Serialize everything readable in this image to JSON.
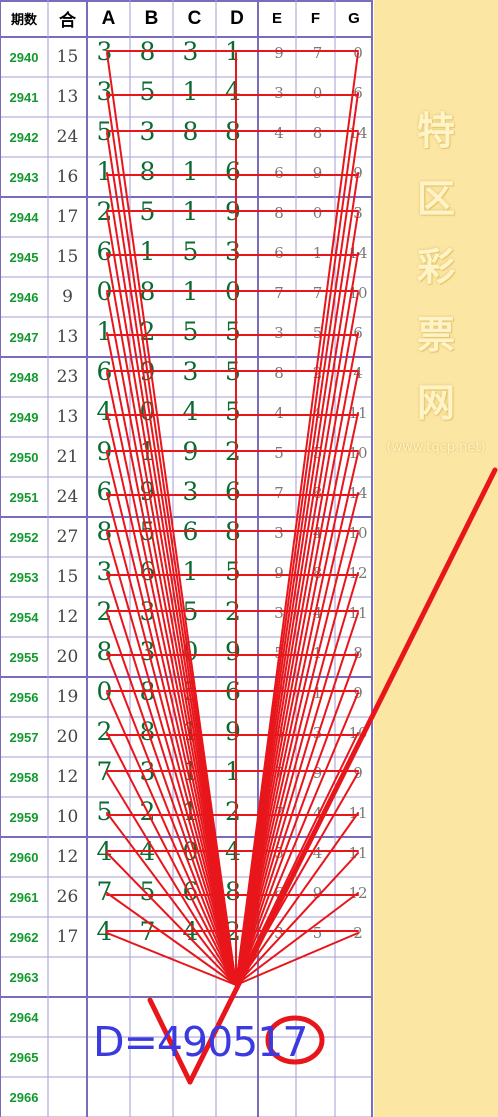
{
  "headers": {
    "period": "期数",
    "sum": "合",
    "cols": [
      "A",
      "B",
      "C",
      "D",
      "E",
      "F",
      "G"
    ]
  },
  "rows": [
    {
      "period": "2940",
      "sum": "15",
      "a": "3",
      "b": "8",
      "c": "3",
      "d": "1",
      "e": "9",
      "f": "7",
      "g": "0"
    },
    {
      "period": "2941",
      "sum": "13",
      "a": "3",
      "b": "5",
      "c": "1",
      "d": "4",
      "e": "3",
      "f": "0",
      "g": "6"
    },
    {
      "period": "2942",
      "sum": "24",
      "a": "5",
      "b": "3",
      "c": "8",
      "d": "8",
      "e": "4",
      "f": "8",
      "g": "14"
    },
    {
      "period": "2943",
      "sum": "16",
      "a": "1",
      "b": "8",
      "c": "1",
      "d": "6",
      "e": "6",
      "f": "9",
      "g": "9"
    },
    {
      "period": "2944",
      "sum": "17",
      "a": "2",
      "b": "5",
      "c": "1",
      "d": "9",
      "e": "8",
      "f": "0",
      "g": "3"
    },
    {
      "period": "2945",
      "sum": "15",
      "a": "6",
      "b": "1",
      "c": "5",
      "d": "3",
      "e": "6",
      "f": "1",
      "g": "14"
    },
    {
      "period": "2946",
      "sum": "9",
      "a": "0",
      "b": "8",
      "c": "1",
      "d": "0",
      "e": "7",
      "f": "7",
      "g": "10"
    },
    {
      "period": "2947",
      "sum": "13",
      "a": "1",
      "b": "2",
      "c": "5",
      "d": "5",
      "e": "3",
      "f": "5",
      "g": "6"
    },
    {
      "period": "2948",
      "sum": "23",
      "a": "6",
      "b": "9",
      "c": "3",
      "d": "5",
      "e": "8",
      "f": "2",
      "g": "4"
    },
    {
      "period": "2949",
      "sum": "13",
      "a": "4",
      "b": "0",
      "c": "4",
      "d": "5",
      "e": "4",
      "f": "4",
      "g": "11"
    },
    {
      "period": "2950",
      "sum": "21",
      "a": "9",
      "b": "1",
      "c": "9",
      "d": "2",
      "e": "5",
      "f": "5",
      "g": "10"
    },
    {
      "period": "2951",
      "sum": "24",
      "a": "6",
      "b": "9",
      "c": "3",
      "d": "6",
      "e": "7",
      "f": "8",
      "g": "14"
    },
    {
      "period": "2952",
      "sum": "27",
      "a": "8",
      "b": "5",
      "c": "6",
      "d": "8",
      "e": "3",
      "f": "4",
      "g": "10"
    },
    {
      "period": "2953",
      "sum": "15",
      "a": "3",
      "b": "6",
      "c": "1",
      "d": "5",
      "e": "9",
      "f": "8",
      "g": "12"
    },
    {
      "period": "2954",
      "sum": "12",
      "a": "2",
      "b": "3",
      "c": "5",
      "d": "2",
      "e": "3",
      "f": "4",
      "g": "11"
    },
    {
      "period": "2955",
      "sum": "20",
      "a": "8",
      "b": "3",
      "c": "0",
      "d": "9",
      "e": "5",
      "f": "1",
      "g": "8"
    },
    {
      "period": "2956",
      "sum": "19",
      "a": "0",
      "b": "8",
      "c": "5",
      "d": "6",
      "e": "7",
      "f": "1",
      "g": "9"
    },
    {
      "period": "2957",
      "sum": "20",
      "a": "2",
      "b": "8",
      "c": "1",
      "d": "9",
      "e": "6",
      "f": "3",
      "g": "10"
    },
    {
      "period": "2958",
      "sum": "12",
      "a": "7",
      "b": "3",
      "c": "1",
      "d": "1",
      "e": "7",
      "f": "9",
      "g": "9"
    },
    {
      "period": "2959",
      "sum": "10",
      "a": "5",
      "b": "2",
      "c": "1",
      "d": "2",
      "e": "7",
      "f": "4",
      "g": "11"
    },
    {
      "period": "2960",
      "sum": "12",
      "a": "4",
      "b": "4",
      "c": "0",
      "d": "4",
      "e": "5",
      "f": "4",
      "g": "11"
    },
    {
      "period": "2961",
      "sum": "26",
      "a": "7",
      "b": "5",
      "c": "6",
      "d": "8",
      "e": "6",
      "f": "9",
      "g": "12"
    },
    {
      "period": "2962",
      "sum": "17",
      "a": "4",
      "b": "7",
      "c": "4",
      "d": "2",
      "e": "3",
      "f": "5",
      "g": "2"
    },
    {
      "period": "2963",
      "sum": "",
      "a": "",
      "b": "",
      "c": "",
      "d": "",
      "e": "",
      "f": "",
      "g": ""
    },
    {
      "period": "2964",
      "sum": "",
      "a": "",
      "b": "",
      "c": "",
      "d": "",
      "e": "",
      "f": "",
      "g": ""
    },
    {
      "period": "2965",
      "sum": "",
      "a": "",
      "b": "",
      "c": "",
      "d": "",
      "e": "",
      "f": "",
      "g": ""
    },
    {
      "period": "2966",
      "sum": "",
      "a": "",
      "b": "",
      "c": "",
      "d": "",
      "e": "",
      "f": "",
      "g": ""
    }
  ],
  "formula": "D=490517",
  "watermark": {
    "chars": [
      "特",
      "区",
      "彩",
      "票",
      "网"
    ],
    "url": "(www.tqcp.net)"
  },
  "colors": {
    "grid_line": "#a59bd3",
    "group_line": "#7b6bbb",
    "period_text": "#129a2e",
    "big_digit": "#0c6b33",
    "small_digit": "#7a7a7a",
    "annotation": "#e8161b",
    "formula": "#3a3adf",
    "side_panel": "#fbe6a4"
  }
}
